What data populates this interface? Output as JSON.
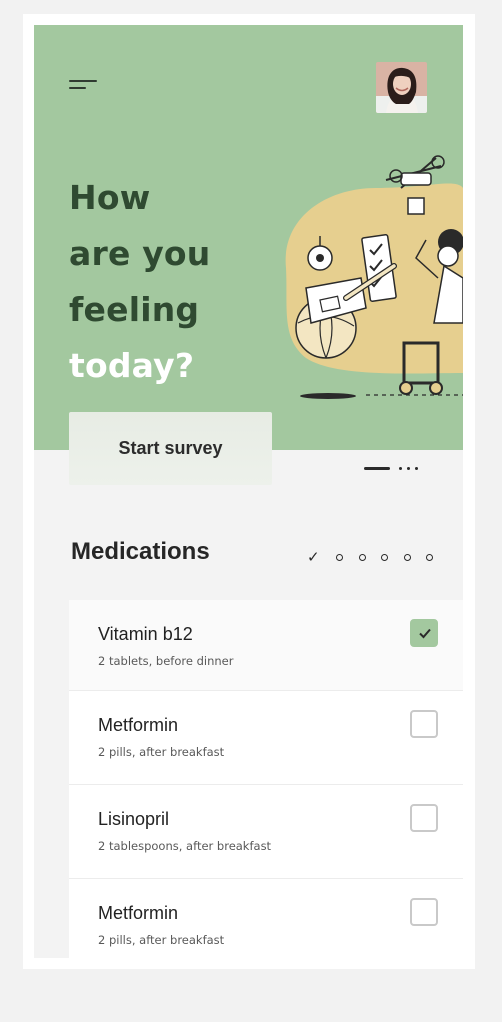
{
  "hero": {
    "headline_line1": "How",
    "headline_line2": "are you",
    "headline_line3": "feeling",
    "headline_line4": "today?",
    "start_button_label": "Start survey",
    "background_color": "#a3c89f",
    "pager": {
      "pages": 4,
      "active_index": 0
    }
  },
  "medications": {
    "title": "Medications",
    "days": {
      "count": 6,
      "completed": 1
    },
    "items": [
      {
        "name": "Vitamin b12",
        "dose": "2 tablets, before dinner",
        "checked": true
      },
      {
        "name": "Metformin",
        "dose": "2 pills, after breakfast",
        "checked": false
      },
      {
        "name": "Lisinopril",
        "dose": "2 tablespoons, after breakfast",
        "checked": false
      },
      {
        "name": "Metformin",
        "dose": "2 pills, after breakfast",
        "checked": false
      }
    ]
  },
  "icons": {
    "menu": "menu-icon",
    "check": "check-icon",
    "avatar": "user-avatar"
  },
  "colors": {
    "accent": "#a3c89f",
    "headline_dark": "#2f4a31",
    "illustration_blob": "#e6cf8f"
  }
}
